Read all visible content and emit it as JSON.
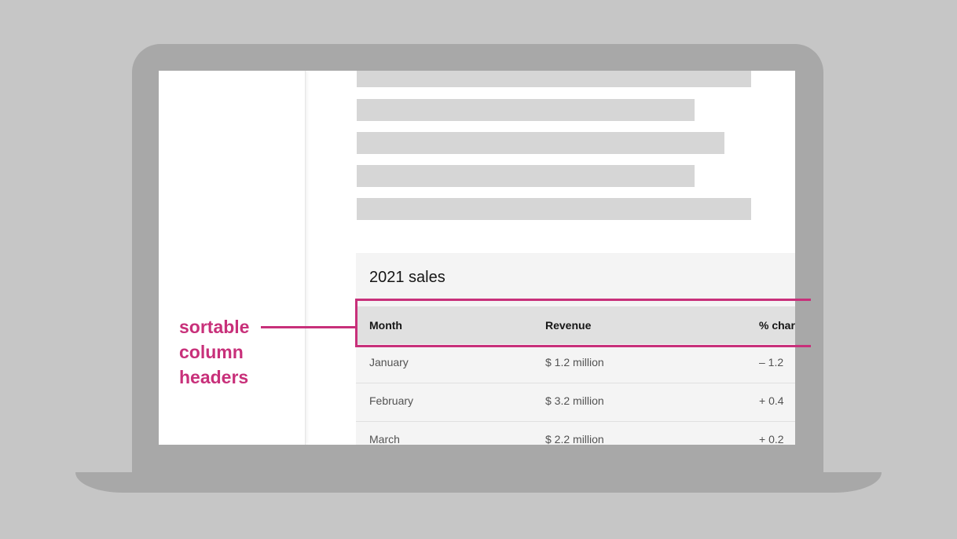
{
  "table": {
    "title": "2021 sales",
    "headers": [
      "Month",
      "Revenue",
      "% char"
    ],
    "rows": [
      [
        "January",
        "$ 1.2 million",
        "– 1.2"
      ],
      [
        "February",
        "$ 3.2 million",
        "+ 0.4"
      ],
      [
        "March",
        "$ 2.2 million",
        "+ 0.2"
      ]
    ]
  },
  "annotation": {
    "lines": [
      "sortable",
      "column",
      "headers"
    ],
    "color": "#c8307a"
  },
  "colors": {
    "background": "#c6c6c6",
    "device": "#a8a8a8",
    "skeleton": "#d6d6d6",
    "table_bg": "#f4f4f4",
    "header_bg": "#e0e0e0"
  }
}
